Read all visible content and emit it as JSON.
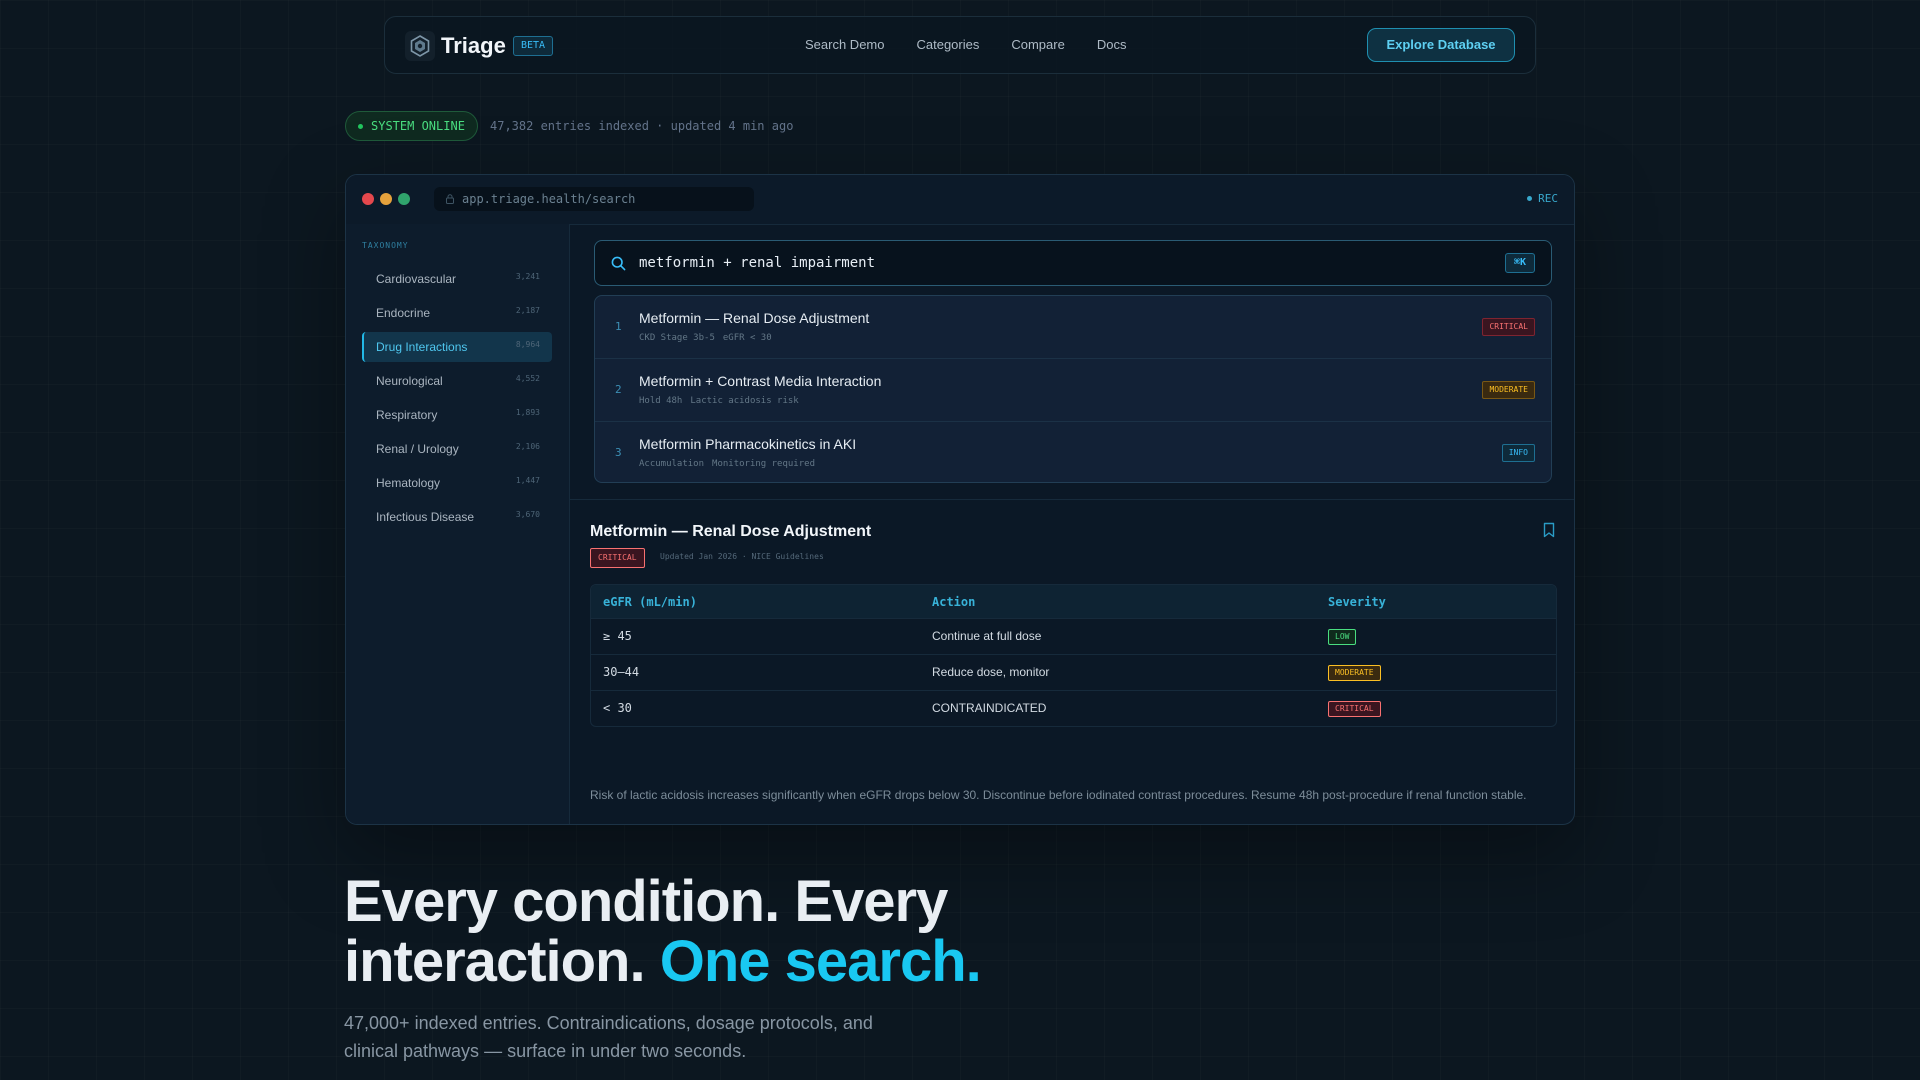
{
  "nav": {
    "brand": "Triage",
    "beta": "BETA",
    "links": [
      "Search Demo",
      "Categories",
      "Compare",
      "Docs"
    ],
    "cta": "Explore Database"
  },
  "status": {
    "label": "SYSTEM ONLINE",
    "meta": "47,382 entries indexed · updated 4 min ago"
  },
  "window": {
    "url": "app.triage.health/search",
    "rec": "REC"
  },
  "sidebar": {
    "heading": "TAXONOMY",
    "items": [
      {
        "label": "Cardiovascular",
        "count": "3,241"
      },
      {
        "label": "Endocrine",
        "count": "2,187"
      },
      {
        "label": "Drug Interactions",
        "count": "8,964",
        "active": true
      },
      {
        "label": "Neurological",
        "count": "4,552"
      },
      {
        "label": "Respiratory",
        "count": "1,893"
      },
      {
        "label": "Renal / Urology",
        "count": "2,106"
      },
      {
        "label": "Hematology",
        "count": "1,447"
      },
      {
        "label": "Infectious Disease",
        "count": "3,670"
      }
    ]
  },
  "search": {
    "query": "metformin + renal impairment",
    "shortcut": "⌘K"
  },
  "results": [
    {
      "index": "1",
      "title": "Metformin — Renal Dose Adjustment",
      "tags": [
        "CKD Stage 3b-5",
        "eGFR < 30"
      ],
      "badge": "CRITICAL",
      "level": "critical"
    },
    {
      "index": "2",
      "title": "Metformin + Contrast Media Interaction",
      "tags": [
        "Hold 48h",
        "Lactic acidosis risk"
      ],
      "badge": "MODERATE",
      "level": "moderate"
    },
    {
      "index": "3",
      "title": "Metformin Pharmacokinetics in AKI",
      "tags": [
        "Accumulation",
        "Monitoring required"
      ],
      "badge": "INFO",
      "level": "info"
    }
  ],
  "detail": {
    "title": "Metformin — Renal Dose Adjustment",
    "badge": "CRITICAL",
    "meta": "Updated Jan 2026 · NICE Guidelines",
    "columns": [
      "eGFR (mL/min)",
      "Action",
      "Severity"
    ],
    "rows": [
      {
        "egfr": "≥ 45",
        "action": "Continue at full dose",
        "severity": "LOW",
        "level": "low"
      },
      {
        "egfr": "30–44",
        "action": "Reduce dose, monitor",
        "severity": "MODERATE",
        "level": "moderate"
      },
      {
        "egfr": "< 30",
        "action": "CONTRAINDICATED",
        "severity": "CRITICAL",
        "level": "critical"
      }
    ],
    "note": "Risk of lactic acidosis increases significantly when eGFR drops below 30. Discontinue before iodinated contrast procedures. Resume 48h post-procedure if renal function stable."
  },
  "hero": {
    "line1": "Every condition. Every",
    "line2_plain": "interaction. ",
    "line2_accent": "One search.",
    "sub": "47,000+ indexed entries. Contraindications, dosage protocols, and clinical pathways — surface in under two seconds."
  },
  "colors": {
    "accent": "#19c8f2",
    "critical": "#f87171",
    "moderate": "#fbbf24",
    "info": "#38bdf8",
    "low": "#4ade80",
    "online": "#22c55e"
  }
}
